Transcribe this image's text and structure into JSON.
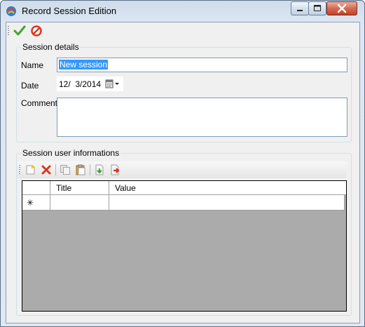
{
  "window": {
    "title": "Record Session Edition"
  },
  "toolbar": {
    "ok_icon": "checkmark-icon",
    "cancel_icon": "cancel-icon"
  },
  "details": {
    "title": "Session details",
    "name_label": "Name",
    "name_value": "New session",
    "date_label": "Date",
    "date_value": "12/  3/2014",
    "comment_label": "Comment",
    "comment_value": ""
  },
  "infos": {
    "title": "Session user informations",
    "toolbar_icons": [
      "new-icon",
      "delete-icon",
      "copy-icon",
      "paste-icon",
      "import-icon",
      "export-icon"
    ],
    "columns": [
      "Title",
      "Value"
    ],
    "new_row_marker": "✳"
  },
  "colors": {
    "accent_green": "#3fa62c",
    "delete_red": "#d9391e",
    "grid_empty": "#ababab",
    "selection": "#3399ff"
  }
}
